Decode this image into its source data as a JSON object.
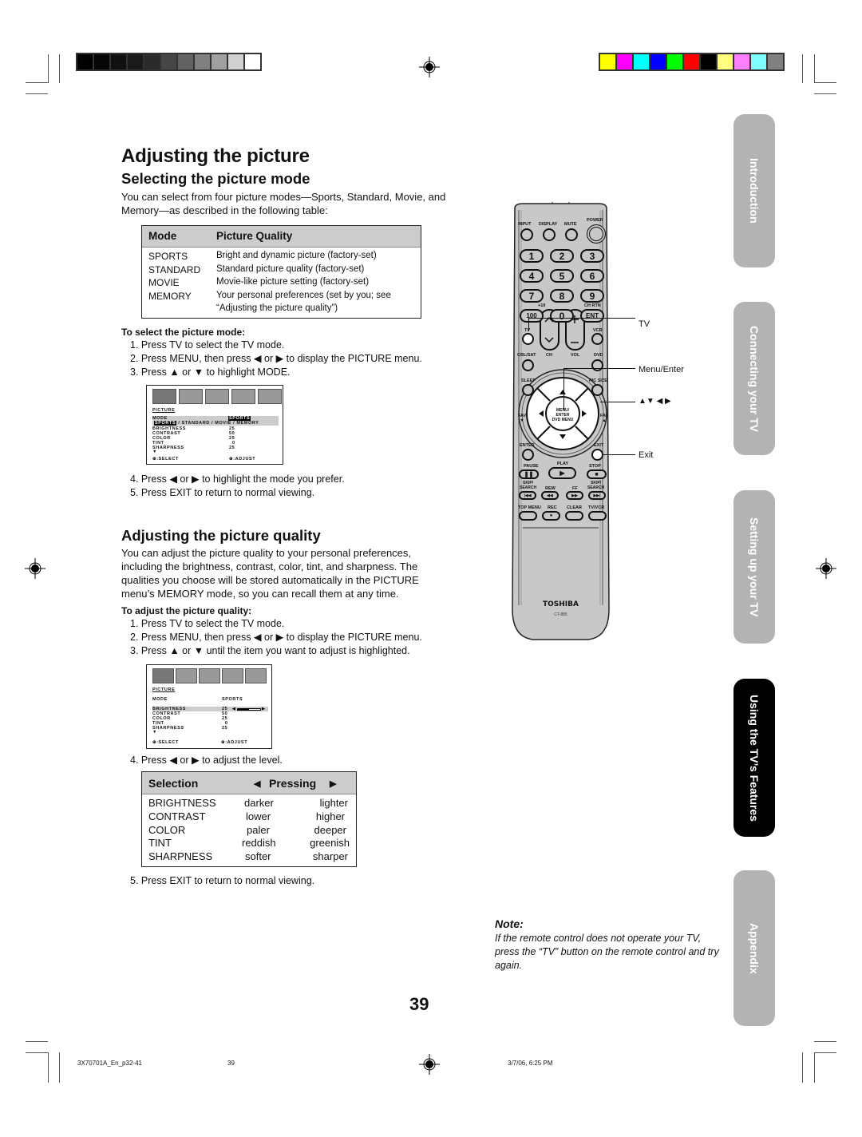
{
  "print_marks": {
    "grayscale": [
      "#000000",
      "#060606",
      "#101010",
      "#1a1a1a",
      "#2a2a2a",
      "#464646",
      "#626262",
      "#808080",
      "#a0a0a0",
      "#d0d0d0",
      "#ffffff"
    ],
    "color": [
      "#ffff00",
      "#ff00ff",
      "#00ffff",
      "#0000ff",
      "#00ff00",
      "#ff0000",
      "#000000",
      "#ffff80",
      "#ff80ff",
      "#80ffff",
      "#808080"
    ]
  },
  "page": {
    "title": "Adjusting the picture",
    "page_number": "39"
  },
  "section1": {
    "heading": "Selecting the picture mode",
    "intro": "You can select from four picture modes—Sports, Standard, Movie, and Memory—as described in the following table:",
    "table": {
      "headers": [
        "Mode",
        "Picture Quality"
      ],
      "rows": [
        {
          "mode": "SPORTS",
          "quality": "Bright and dynamic picture (factory-set)"
        },
        {
          "mode": "STANDARD",
          "quality": "Standard picture quality (factory-set)"
        },
        {
          "mode": "MOVIE",
          "quality": "Movie-like picture setting  (factory-set)"
        },
        {
          "mode": "MEMORY",
          "quality": "Your personal preferences (set by you; see"
        },
        {
          "mode": "",
          "quality": "“Adjusting the picture quality”)"
        }
      ]
    },
    "procedure_title": "To select the picture mode:",
    "steps_a": [
      "1. Press TV to select the TV mode.",
      "2. Press MENU, then press ◀ or ▶ to display the PICTURE menu.",
      "3. Press ▲ or ▼ to highlight MODE."
    ],
    "osd": {
      "title": "PICTURE",
      "mode_label": "MODE",
      "mode_value": "SPORTS",
      "mode_options_selected": "SPORTS",
      "mode_options_rest": " / STANDARD / MOVIE / MEMORY",
      "items": [
        {
          "label": "BRIGHTNESS",
          "value": "25"
        },
        {
          "label": "CONTRAST",
          "value": "50"
        },
        {
          "label": "COLOR",
          "value": "25"
        },
        {
          "label": "TINT",
          "value": "0"
        },
        {
          "label": "SHARPNESS",
          "value": "25"
        }
      ],
      "more": "▼",
      "select_hint": "⊕:SELECT",
      "adjust_hint": "⊕:ADJUST"
    },
    "steps_b": [
      "4. Press ◀ or ▶ to highlight the mode you prefer.",
      "5. Press EXIT to return to normal viewing."
    ]
  },
  "section2": {
    "heading": "Adjusting the picture quality",
    "intro": "You can adjust the picture quality to your personal preferences, including the brightness, contrast, color, tint, and sharpness. The qualities you choose will be stored automatically in the PICTURE menu’s MEMORY mode, so you can recall them at any time.",
    "procedure_title": "To adjust the picture quality:",
    "steps_a": [
      "1. Press TV to select the TV mode.",
      "2. Press MENU, then press ◀ or ▶ to display the PICTURE menu.",
      "3. Press ▲ or ▼ until the item you want to adjust is highlighted."
    ],
    "osd": {
      "title": "PICTURE",
      "mode_label": "MODE",
      "mode_value": "SPORTS",
      "items": [
        {
          "label": "BRIGHTNESS",
          "value": "25"
        },
        {
          "label": "CONTRAST",
          "value": "50"
        },
        {
          "label": "COLOR",
          "value": "25"
        },
        {
          "label": "TINT",
          "value": "0"
        },
        {
          "label": "SHARPNESS",
          "value": "25"
        }
      ],
      "brightness_level_fraction": 0.5,
      "more": "▼",
      "select_hint": "⊕:SELECT",
      "adjust_hint": "⊕:ADJUST"
    },
    "step4": "4. Press ◀ or ▶ to adjust the level.",
    "table": {
      "header_selection": "Selection",
      "header_pressing": "Pressing",
      "left_arrow": "◀",
      "right_arrow": "▶",
      "rows": [
        {
          "selection": "BRIGHTNESS",
          "left": "darker",
          "right": "lighter"
        },
        {
          "selection": "CONTRAST",
          "left": "lower",
          "right": "higher"
        },
        {
          "selection": "COLOR",
          "left": "paler",
          "right": "deeper"
        },
        {
          "selection": "TINT",
          "left": "reddish",
          "right": "greenish"
        },
        {
          "selection": "SHARPNESS",
          "left": "softer",
          "right": "sharper"
        }
      ]
    },
    "step5": "5. Press EXIT to return to normal viewing."
  },
  "remote": {
    "labels": {
      "input": "INPUT",
      "display": "DISPLAY",
      "mute": "MUTE",
      "power": "POWER",
      "plus10": "+10",
      "ch_rtn": "CH RTN",
      "tv": "TV",
      "vcr": "VCR",
      "cbl_sat": "CBL/SAT",
      "dvd": "DVD",
      "ch": "CH",
      "vol": "VOL",
      "sleep": "SLEEP",
      "pic_size": "PIC SIZE",
      "fav_down": "FAV\n▼",
      "fav_up": "FAV\n▲",
      "menu_enter": "MENU/\nENTER\nDVD MENU",
      "enter": "ENTER",
      "exit": "EXIT",
      "pause": "PAUSE",
      "play": "PLAY",
      "stop": "STOP",
      "skip_back": "SKIP/\nSEARCH",
      "rew": "REW",
      "ff": "FF",
      "skip_fwd": "SKIP/\nSEARCH",
      "top_menu": "TOP MENU",
      "rec": "REC",
      "clear": "CLEAR",
      "tv_vcr": "TV/VCR"
    },
    "digits": [
      "1",
      "2",
      "3",
      "4",
      "5",
      "6",
      "7",
      "8",
      "9",
      "100",
      "0",
      "ENT"
    ],
    "brand": "TOSHIBA",
    "model": "CT-885",
    "callouts": {
      "tv": "TV",
      "menu_enter": "Menu/Enter",
      "arrows": "▲▼ ◀ ▶",
      "exit": "Exit"
    }
  },
  "side_tabs": [
    {
      "label": "Introduction",
      "active": false
    },
    {
      "label": "Connecting your TV",
      "active": false
    },
    {
      "label": "Setting up your TV",
      "active": false
    },
    {
      "label": "Using the TV’s Features",
      "active": true
    },
    {
      "label": "Appendix",
      "active": false
    }
  ],
  "note": {
    "title": "Note:",
    "body": "If the remote control does not operate your TV, press the “TV” button on the remote control and try again."
  },
  "footer": {
    "file": "3X70701A_En_p32-41",
    "page": "39",
    "timestamp": "3/7/06, 6:25 PM"
  }
}
